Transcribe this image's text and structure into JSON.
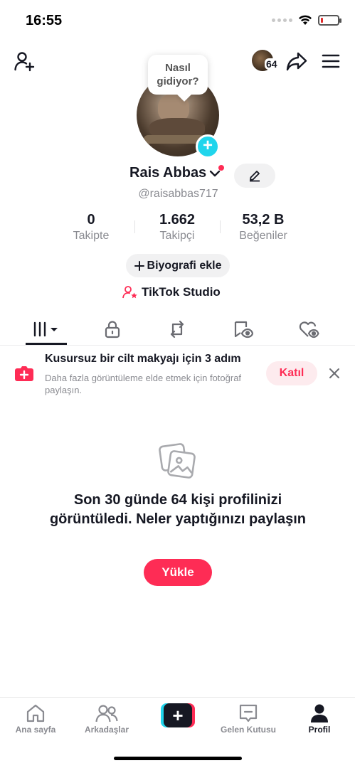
{
  "status_bar": {
    "time": "16:55",
    "battery_level": 0.15,
    "battery_color": "#e02b2b"
  },
  "top_bar": {
    "viewer_count": "64"
  },
  "profile": {
    "bubble_text_line1": "Nasıl",
    "bubble_text_line2": "gidiyor?",
    "name": "Rais Abbas",
    "handle": "@raisabbas717",
    "stats": [
      {
        "value": "0",
        "label": "Takipte"
      },
      {
        "value": "1.662",
        "label": "Takipçi"
      },
      {
        "value": "53,2 B",
        "label": "Beğeniler"
      }
    ],
    "bio_button": "Biyografi ekle",
    "studio_link": "TikTok Studio"
  },
  "tabs": [
    {
      "icon": "grid-icon"
    },
    {
      "icon": "lock-icon"
    },
    {
      "icon": "repost-icon"
    },
    {
      "icon": "tagged-icon"
    },
    {
      "icon": "liked-icon"
    }
  ],
  "promo": {
    "title": "Kusursuz bir cilt makyajı için 3 adım",
    "subtitle": "Daha fazla görüntüleme elde etmek için fotoğraf paylaşın.",
    "join_label": "Katıl"
  },
  "empty_state": {
    "message": "Son 30 günde 64 kişi profilinizi görüntüledi. Neler yaptığınızı paylaşın",
    "upload_label": "Yükle"
  },
  "bottom_nav": [
    {
      "label": "Ana sayfa"
    },
    {
      "label": "Arkadaşlar"
    },
    {
      "label": "Gelen Kutusu"
    },
    {
      "label": "Profil"
    }
  ],
  "colors": {
    "accent": "#fe2c55",
    "cyan": "#20d5ec",
    "text": "#161823",
    "muted": "#8a8b91"
  }
}
